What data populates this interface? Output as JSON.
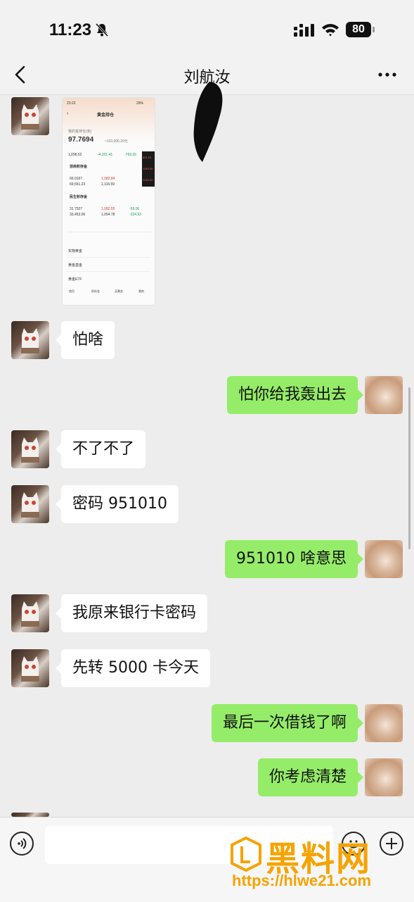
{
  "status_bar": {
    "time": "11:23",
    "battery": "80"
  },
  "header": {
    "title": "刘航汝"
  },
  "shared_image": {
    "app_time": "23:22",
    "battery": "29%",
    "title": "黄金持仓",
    "holding_label": "我的金持仓(克)",
    "holding_value": "97.7694",
    "holding_sub": "≈103,006.29元",
    "stat1_value": "1,096.52",
    "stat2_value": "-4,201.41",
    "stat3_value": "-769.39",
    "bank1_name": "浙商积存金",
    "bank1_row1": "66.0167",
    "bank1_row1b": "1,082.84",
    "bank1_row2": "69,551.23",
    "bank1_row2b": "1,116.59",
    "bank2_name": "民生积存金",
    "bank2_row1": "31.7527",
    "bank2_row1b": "1,082.55",
    "bank2_row2": "33,453.06",
    "bank2_row2b": "1,054.78",
    "bank2_row1c": "-59.06",
    "bank2_row2c": "-334.93",
    "side_prices": [
      "801.53",
      "1083.55",
      "1083.50"
    ],
    "list_items": [
      "实物黄金",
      "黄金基金",
      "黄金ETF"
    ],
    "tabs": [
      "首页",
      "积存金",
      "买黄金",
      "我的"
    ]
  },
  "messages": [
    {
      "side": "in",
      "text": "怕啥"
    },
    {
      "side": "out",
      "text": "怕你给我轰出去"
    },
    {
      "side": "in",
      "text": "不了不了"
    },
    {
      "side": "in",
      "text": "密码 951010"
    },
    {
      "side": "out",
      "text": "951010 啥意思"
    },
    {
      "side": "in",
      "text": "我原来银行卡密码"
    },
    {
      "side": "in",
      "text": "先转 5000 卡今天"
    },
    {
      "side": "out",
      "text": "最后一次借钱了啊"
    },
    {
      "side": "out",
      "text": "你考虑清楚"
    }
  ],
  "input": {
    "placeholder": ""
  },
  "watermark": {
    "brand": "黑料网",
    "url": "https://hlwe21.com"
  },
  "colors": {
    "out_bubble": "#95ec69",
    "in_bubble": "#ffffff",
    "background": "#ededed",
    "watermark": "#f5a300"
  }
}
